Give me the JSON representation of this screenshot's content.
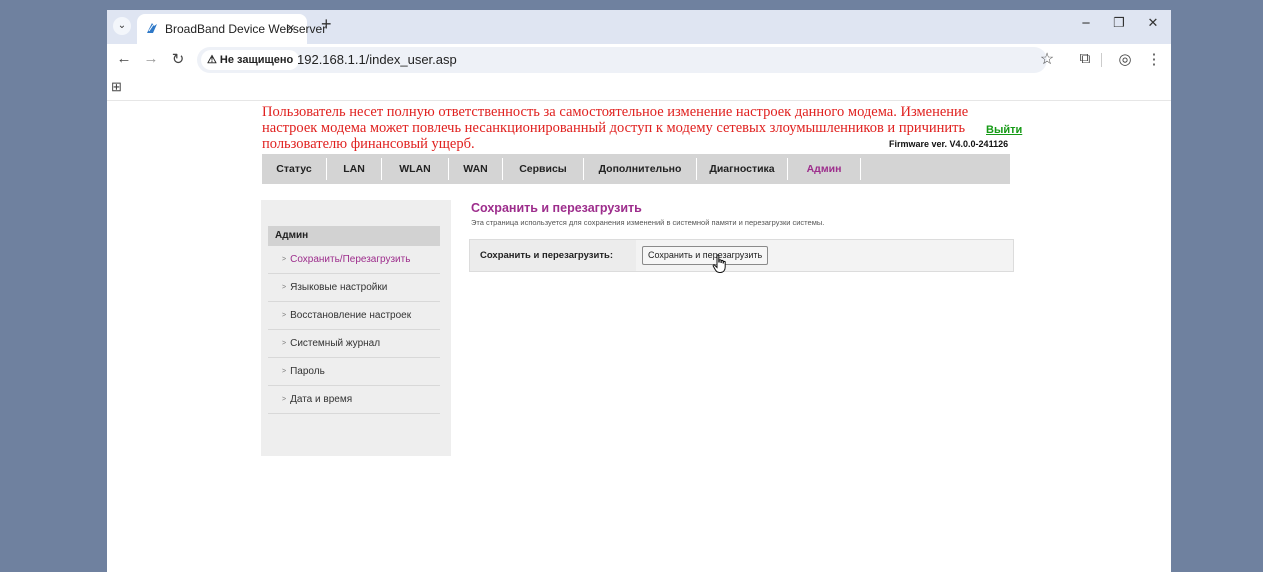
{
  "browser": {
    "tab_title": "BroadBand Device Webserver",
    "tab_close": "×",
    "new_tab": "+",
    "tab_list": "⌄",
    "security_label": "⚠ Не защищено",
    "url": "192.168.1.1/index_user.asp",
    "icons": {
      "back": "←",
      "forward": "→",
      "reload": "↻",
      "bookmark": "☆",
      "extensions": "⧉",
      "profile": "◎",
      "menu": "⋮",
      "apps": "⊞",
      "minimize": "−",
      "restore": "❐",
      "close": "✕"
    }
  },
  "page": {
    "warning_text": "Пользователь несет полную ответственность за самостоятельное изменение настроек данного модема. Изменение настроек модема может повлечь несанкционированный доступ к модему сетевых злоумышленников и причинить пользователю финансовый ущерб.",
    "logout_label": "Выйти",
    "firmware": "Firmware ver. V4.0.0-241126",
    "menu": [
      {
        "label": "Статус"
      },
      {
        "label": "LAN"
      },
      {
        "label": "WLAN"
      },
      {
        "label": "WAN"
      },
      {
        "label": "Сервисы"
      },
      {
        "label": "Дополнительно"
      },
      {
        "label": "Диагностика"
      },
      {
        "label": "Админ"
      }
    ],
    "sidebar": {
      "title": "Админ",
      "items": [
        {
          "label": "Сохранить/Перезагрузить"
        },
        {
          "label": "Языковые настройки"
        },
        {
          "label": "Восстановление настроек"
        },
        {
          "label": "Системный журнал"
        },
        {
          "label": "Пароль"
        },
        {
          "label": "Дата и время"
        }
      ]
    },
    "content": {
      "title": "Сохранить и перезагрузить",
      "description": "Эта страница используется для сохранения изменений в системной памяти и перезагрузки системы.",
      "form_label": "Сохранить и перезагрузить:",
      "button_label": "Сохранить и перезагрузить"
    }
  },
  "colors": {
    "warning": "#e0211f",
    "accent": "#9d2d8c",
    "logout": "#169a16",
    "menubar": "#d4d4d4"
  }
}
